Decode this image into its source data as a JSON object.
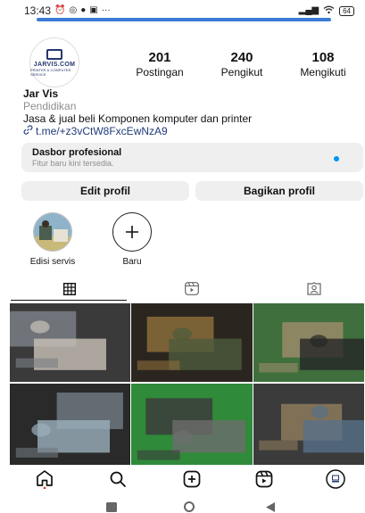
{
  "status": {
    "time": "13:43",
    "battery": "64",
    "more": "···"
  },
  "profile": {
    "avatar_logo_text": "JARVIS.COM",
    "avatar_logo_sub": "PRINTER & COMPUTER SERVICE",
    "stats": [
      {
        "value": "201",
        "label": "Postingan"
      },
      {
        "value": "240",
        "label": "Pengikut"
      },
      {
        "value": "108",
        "label": "Mengikuti"
      }
    ],
    "name": "Jar Vis",
    "category": "Pendidikan",
    "bio": "Jasa & jual beli Komponen komputer dan printer",
    "link": "t.me/+z3vCtW8FxcEwNzA9"
  },
  "dashboard": {
    "title": "Dasbor profesional",
    "subtitle": "Fitur baru kini tersedia."
  },
  "buttons": {
    "edit": "Edit profil",
    "share": "Bagikan profil"
  },
  "highlights": [
    {
      "label": "Edisi servis"
    },
    {
      "label": "Baru"
    }
  ],
  "tabs": [
    {
      "icon": "grid-icon"
    },
    {
      "icon": "reels-icon"
    },
    {
      "icon": "tagged-icon"
    }
  ],
  "posts": [
    {
      "subject": "laptop repair",
      "colors": [
        "#3a3a3a",
        "#7a7f86",
        "#c9c2b8"
      ]
    },
    {
      "subject": "pc internals",
      "colors": [
        "#2b2520",
        "#8a6d3b",
        "#4d5b3c"
      ]
    },
    {
      "subject": "motherboard repair",
      "colors": [
        "#3f6f3c",
        "#9a8b6a",
        "#262626"
      ]
    },
    {
      "subject": "laptop motherboard",
      "colors": [
        "#2a2a2a",
        "#6f7880",
        "#9bb0bd"
      ]
    },
    {
      "subject": "printer internals",
      "colors": [
        "#2f8a3a",
        "#3c3c3c",
        "#6d6d6d"
      ]
    },
    {
      "subject": "board repair",
      "colors": [
        "#3b3b3b",
        "#8d7a5c",
        "#57708a"
      ]
    }
  ],
  "bottom_nav": [
    "home-icon",
    "search-icon",
    "create-icon",
    "reels-icon",
    "profile-icon"
  ],
  "colors": {
    "accent": "#0095f6",
    "link": "#1f3b7a",
    "button_bg": "#efefef",
    "muted": "#8e8e8e"
  }
}
